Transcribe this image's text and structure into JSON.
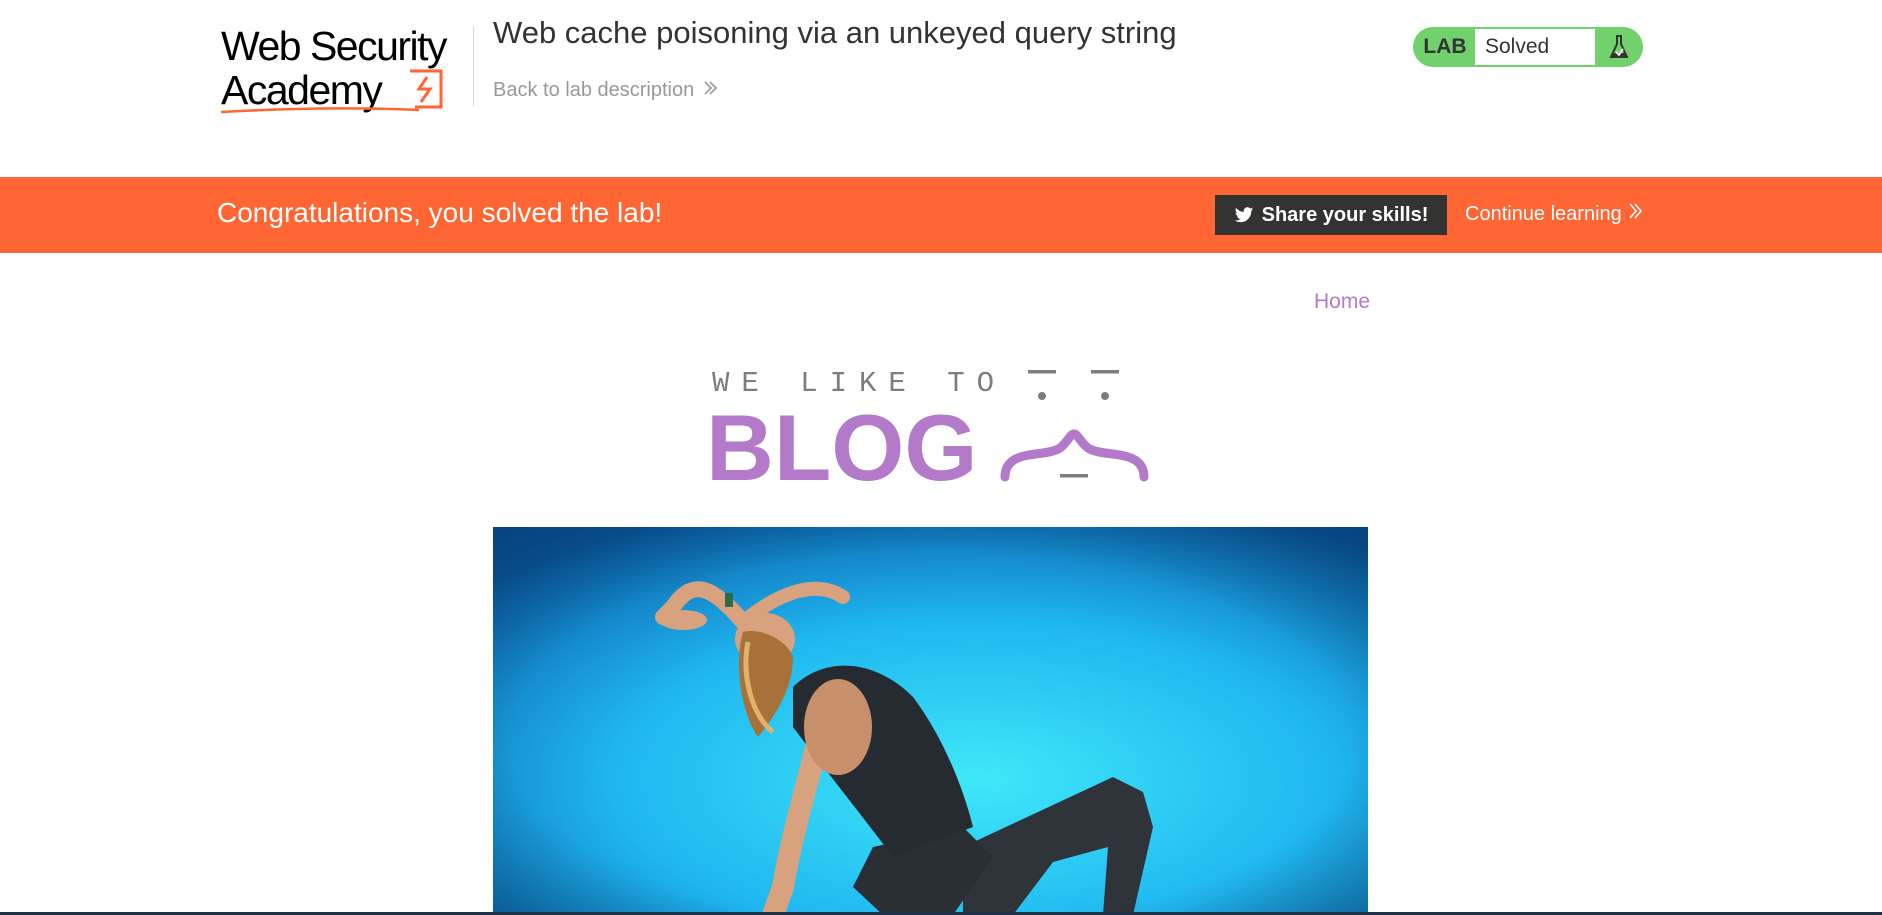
{
  "header": {
    "logo_line1": "Web Security",
    "logo_line2": "Academy",
    "lab_title": "Web cache poisoning via an unkeyed query string",
    "back_link": "Back to lab description",
    "lab_label": "LAB",
    "status": "Solved",
    "status_color": "#70d16d"
  },
  "banner": {
    "message": "Congratulations, you solved the lab!",
    "share_button": "Share your skills!",
    "continue_link": "Continue learning",
    "color": "#ff6633"
  },
  "blog": {
    "nav_home": "Home",
    "logo_top": "WE LIKE TO",
    "logo_main": "BLOG",
    "accent_color": "#b27ac9"
  },
  "icons": {
    "back_chevron": "double-chevron-right-icon",
    "flask": "flask-icon",
    "share": "twitter-bird-icon",
    "continue_chevron": "double-chevron-right-icon"
  }
}
